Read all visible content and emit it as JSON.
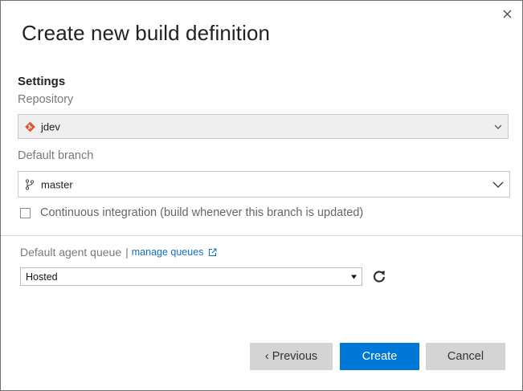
{
  "dialog": {
    "title": "Create new build definition"
  },
  "settings": {
    "heading": "Settings",
    "repository_label": "Repository",
    "repository_value": "jdev",
    "repository_icon": "git-icon",
    "branch_label": "Default branch",
    "branch_value": "master",
    "branch_icon": "branch-icon",
    "ci_label": "Continuous integration (build whenever this branch is updated)",
    "ci_checked": false
  },
  "queue": {
    "label": "Default agent queue",
    "separator": "|",
    "manage_link": "manage queues",
    "selected": "Hosted"
  },
  "buttons": {
    "previous": "‹ Previous",
    "create": "Create",
    "cancel": "Cancel"
  },
  "colors": {
    "accent": "#0078d7",
    "link": "#106ebe",
    "git": "#e2523a"
  }
}
